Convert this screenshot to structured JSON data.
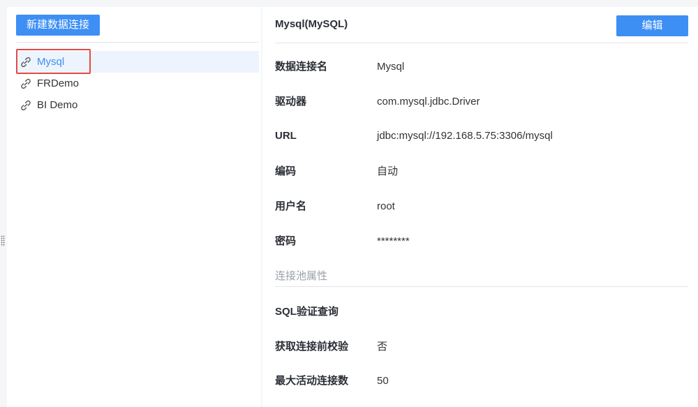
{
  "left": {
    "new_button_label": "新建数据连接",
    "connections": [
      {
        "name": "Mysql",
        "icon": "link-icon",
        "selected": true
      },
      {
        "name": "FRDemo",
        "icon": "link-icon",
        "selected": false
      },
      {
        "name": "BI Demo",
        "icon": "link-icon",
        "selected": false
      }
    ]
  },
  "detail": {
    "title": "Mysql(MySQL)",
    "edit_button_label": "编辑",
    "fields": [
      {
        "label": "数据连接名",
        "value": "Mysql"
      },
      {
        "label": "驱动器",
        "value": "com.mysql.jdbc.Driver"
      },
      {
        "label": "URL",
        "value": "jdbc:mysql://192.168.5.75:3306/mysql"
      },
      {
        "label": "编码",
        "value": "自动"
      },
      {
        "label": "用户名",
        "value": "root"
      },
      {
        "label": "密码",
        "value": "********"
      }
    ],
    "pool_section_label": "连接池属性",
    "pool_fields": [
      {
        "label": "SQL验证查询",
        "value": ""
      },
      {
        "label": "获取连接前校验",
        "value": "否"
      },
      {
        "label": "最大活动连接数",
        "value": "50"
      }
    ]
  },
  "colors": {
    "accent": "#3d8ff4",
    "highlight_border": "#e34a44",
    "selected_bg": "#edf4fd"
  }
}
